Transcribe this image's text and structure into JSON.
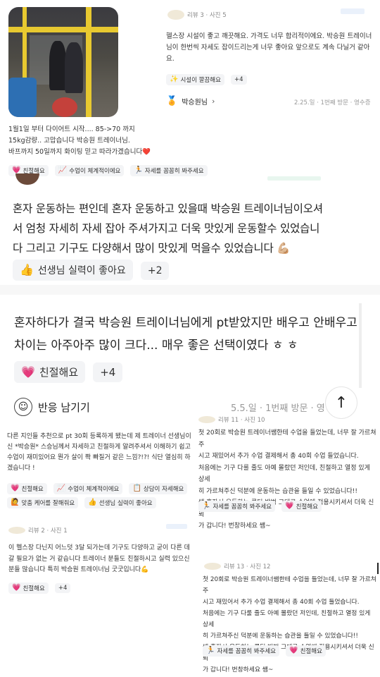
{
  "top_right": {
    "meta": "리뷰 3 · 사진 5",
    "text": "헬스장 시설이 좋고 깨끗해요. 가격도 너무 합리적이에요. 박승원 트레이너 님이 한번씩 자세도 잡이드리는게 너무 좋아요 앞으로도 계속 다닐거 같아요.",
    "chip": "시설이 깔끔해요",
    "plus": "+4",
    "trainer": "박승원님",
    "trainer_arrow": "›",
    "date": "2.25.일 · 1번째 방문 · 영수증"
  },
  "top_left": {
    "text_line1": "1월1일 부터 다이어트 시작.... 85->70 까지",
    "text_line2": "15kg감량.. 고맙습니다 박승원 트레이너님.",
    "text_line3": "바프까지 50일까지 화이팅 믿고 따라가겠습니다❤️",
    "chips": [
      "친절해요",
      "수업이 체계적이에요",
      "자세를 꼼꼼히 봐주세요"
    ]
  },
  "review_big1": {
    "lines": [
      "혼자 운동하는 편인데 혼자 운동하고 있을때 박승원 트레이너님이오셔",
      "서 엄청 자세히 자세 잡아 주셔가지고 더욱 맛있게 운동할수 있었습니",
      "다 그리고 기구도 다양해서 많이 맛있게 먹을수 있었습니다 💪🏼"
    ],
    "chip": "선생님 실력이 좋아요",
    "plus": "+2"
  },
  "review_big2": {
    "lines": [
      "혼자하다가 결국 박승원 트레이너님에게 pt받았지만 배우고 안배우고",
      "차이는 아주아주 많이 크다... 매우 좋은 선택이였다 ㅎ ㅎ"
    ],
    "chip": "친절해요",
    "plus": "+4",
    "reaction": "반응 남기기",
    "date": "5.5.일 · 1번째 방문 · 영",
    "up": "↑"
  },
  "review_left1": {
    "lines": [
      "다른 지인들 추천으로 pt 30회 등록하게 됐는데 제 트레이너 선생님이",
      "신 *박승원* 스승님께서 자세하고 친절하게 알려주셔서 이해하기 쉽고",
      "수업이 재미있어요 뭔가 살이 쫙 빠질거 같은 느낌?!?! 식단 열심히 하",
      "겠습니다 !"
    ],
    "chips_row1": [
      "친절해요",
      "수업이 체계적이에요",
      "상담이 자세해요"
    ],
    "chips_row2": [
      "맞춤 케어를 잘해줘요",
      "선생님 실력이 좋아요"
    ]
  },
  "review_right1": {
    "meta": "리뷰 11 · 사진 10",
    "lines": [
      "첫 20회로 박승원 트레이너쌤한테 수업을 들었는데, 너무 잘 가르쳐주",
      "시고 재밌어서 추가 수업 결제해서 총 40회 수업 들었습니다.",
      "처음에는 기구 다룰 줄도 아예 몰랐던 저인데, 친절하고 열정 있게 상세",
      "히 가르쳐주신 덕분에 운동하는 습관을 들일 수 있었습니다!!",
      "쌤 혼자서 운동하는 루틴 방법 그대로 수업에 적용시키셔서 더욱 신뢰",
      "가 갑니다! 번창하세요 쌤~"
    ],
    "chips": [
      "자세를 꼼꼼히 봐주세요",
      "친절해요"
    ]
  },
  "review_left2": {
    "meta": "리뷰 2 · 사진 1",
    "lines": [
      "이 헬스장 다닌지 어느덧 3달 되가는데 기구도 다양하고 굳이 다른 데",
      "갈 필요가 없는 거 같습니다 트레이너 분들도 친절하시고 실력 있으신",
      "분들 많습니다 특히 박승원 트레이너님 굿굿입니다💪"
    ],
    "chip": "친절해요",
    "plus": "+4"
  },
  "review_right2": {
    "meta": "리뷰 13 · 사진 12",
    "lines": [
      "첫 20회로 박승원 트레이너쌤한테 수업을 들었는데, 너무 잘 가르쳐주",
      "시고 재밌어서 추가 수업 결제해서 총 40회 수업 들었습니다.",
      "처음에는 기구 다룰 줄도 아예 몰랐던 저인데, 친절하고 열정 있게 상세",
      "히 가르쳐주신 덕분에 운동하는 습관을 들일 수 있었습니다!!",
      "쌤 혼자서 운동하는 루틴 방법 그대로 수업에 적용시키셔서 더욱 신뢰",
      "가 갑니다! 번창하세요 쌤~"
    ],
    "chips": [
      "자세를 꼼꼼히 봐주세요",
      "친절해요"
    ]
  },
  "icons": {
    "heart": "💗",
    "chart": "📈",
    "runner": "🏃",
    "sparkle": "✨",
    "thumb": "👍",
    "clipboard": "📋",
    "person": "🙋",
    "smile": "☺",
    "medal": "🏅"
  }
}
